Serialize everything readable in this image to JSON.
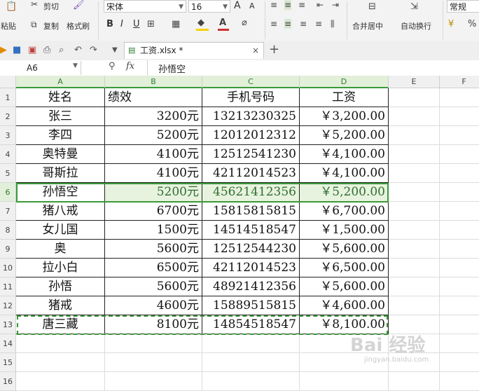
{
  "ribbon": {
    "paste_label": "粘贴",
    "cut_label": "剪切",
    "copy_label": "复制",
    "format_painter_label": "格式刷",
    "font_name": "宋体",
    "font_size": "16",
    "bold": "B",
    "italic": "I",
    "underline": "U",
    "grow_font": "A",
    "shrink_font": "A",
    "merge_center_label": "合并居中",
    "wrap_text_label": "自动换行",
    "number_format": "常规",
    "font_color": "#d03030",
    "fill_color": "#f5d000"
  },
  "quickbar": {
    "tab_title": "工资.xlsx *",
    "close_symbol": "×",
    "add_symbol": "+"
  },
  "formula": {
    "name_box": "A6",
    "fx": "fx",
    "content": "孙悟空"
  },
  "sheet": {
    "columns": [
      "A",
      "B",
      "C",
      "D",
      "E",
      "F"
    ],
    "row_numbers": [
      "1",
      "2",
      "3",
      "4",
      "5",
      "6",
      "7",
      "8",
      "9",
      "10",
      "11",
      "12",
      "13",
      "14",
      "15",
      "16"
    ],
    "header": [
      "姓名",
      "绩效",
      "手机号码",
      "工资"
    ],
    "rows": [
      [
        "张三",
        "3200元",
        "13213230325",
        "￥3,200.00"
      ],
      [
        "李四",
        "5200元",
        "12012012312",
        "￥5,200.00"
      ],
      [
        "奥特曼",
        "4100元",
        "12512541230",
        "￥4,100.00"
      ],
      [
        "哥斯拉",
        "4100元",
        "42112014523",
        "￥4,100.00"
      ],
      [
        "孙悟空",
        "5200元",
        "45621412356",
        "￥5,200.00"
      ],
      [
        "猪八戒",
        "6700元",
        "15815815815",
        "￥6,700.00"
      ],
      [
        "女儿国",
        "1500元",
        "14514518547",
        "￥1,500.00"
      ],
      [
        "奥",
        "5600元",
        "12512544230",
        "￥5,600.00"
      ],
      [
        "拉小白",
        "6500元",
        "42112014523",
        "￥6,500.00"
      ],
      [
        "孙悟",
        "5600元",
        "48921412356",
        "￥5,600.00"
      ],
      [
        "猪戒",
        "4600元",
        "15889515815",
        "￥4,600.00"
      ],
      [
        "唐三藏",
        "8100元",
        "14854518547",
        "￥8,100.00"
      ]
    ],
    "selected_row": "6",
    "selected_color": "#3a9a3a"
  },
  "watermark": {
    "main": "Bai 经验",
    "sub": "jingyan.baidu.com"
  }
}
